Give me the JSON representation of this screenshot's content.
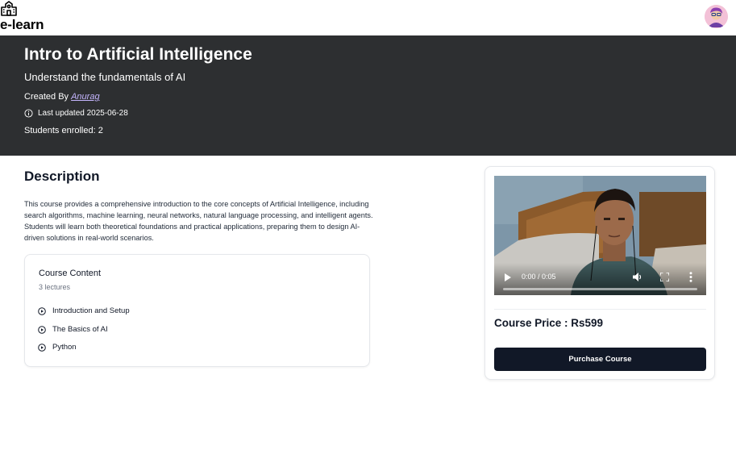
{
  "navbar": {
    "brand": "e-learn",
    "brand_icon": "school-icon",
    "avatar": "avatar"
  },
  "course": {
    "title": "Intro to Artificial Intelligence",
    "subtitle": "Understand the fundamentals of AI",
    "created_by_label": "Created By",
    "creator": "Anurag",
    "last_updated_label": "Last updated",
    "last_updated": "2025-06-28",
    "students_enrolled": "Students enrolled: 2"
  },
  "description": {
    "heading": "Description",
    "text": "This course provides a comprehensive introduction to the core concepts of Artificial Intelligence, including search algorithms, machine learning, neural networks, natural language processing, and intelligent agents. Students will learn both theoretical foundations and practical applications, preparing them to design AI-driven solutions in real-world scenarios."
  },
  "course_content": {
    "title": "Course Content",
    "count": "3 lectures",
    "lectures": [
      {
        "label": "Introduction and Setup",
        "icon": "play-circle-icon"
      },
      {
        "label": "The Basics of AI",
        "icon": "play-circle-icon"
      },
      {
        "label": "Python",
        "icon": "play-circle-icon"
      }
    ]
  },
  "purchase": {
    "video_time": "0:00 / 0:05",
    "video_progress": 0,
    "price": "Course Price : Rs599",
    "button": "Purchase Course"
  },
  "colors": {
    "hero_bg": "#2d2f31",
    "button_bg": "#111827",
    "creator_link": "#c4b5fd"
  }
}
